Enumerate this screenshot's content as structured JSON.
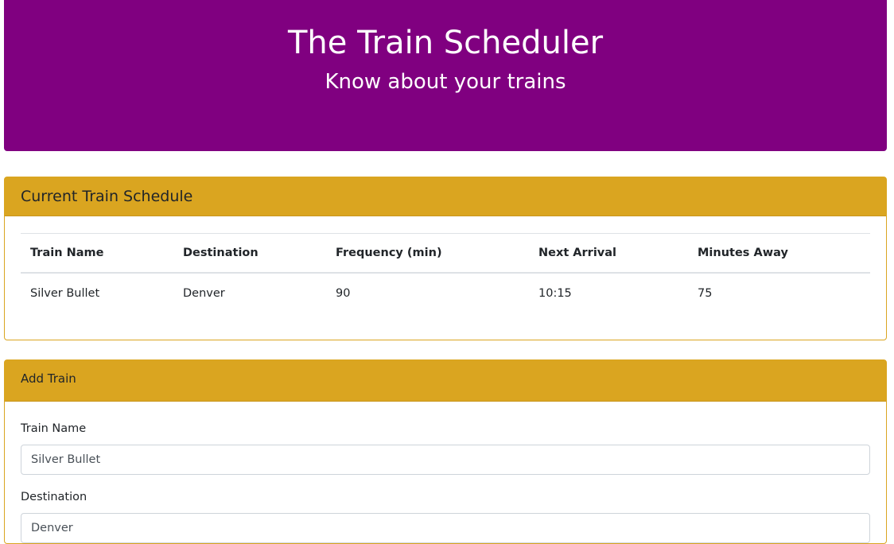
{
  "header": {
    "title": "The Train Scheduler",
    "subtitle": "Know about your trains",
    "background_color": "#800080"
  },
  "schedule": {
    "title": "Current Train Schedule",
    "accent_color": "#daa520",
    "columns": [
      "Train Name",
      "Destination",
      "Frequency (min)",
      "Next Arrival",
      "Minutes Away"
    ],
    "rows": [
      [
        "Silver Bullet",
        "Denver",
        "90",
        "10:15",
        "75"
      ]
    ]
  },
  "add_train": {
    "title": "Add Train",
    "fields": [
      {
        "label": "Train Name",
        "value": "Silver Bullet"
      },
      {
        "label": "Destination",
        "value": "Denver"
      }
    ]
  }
}
